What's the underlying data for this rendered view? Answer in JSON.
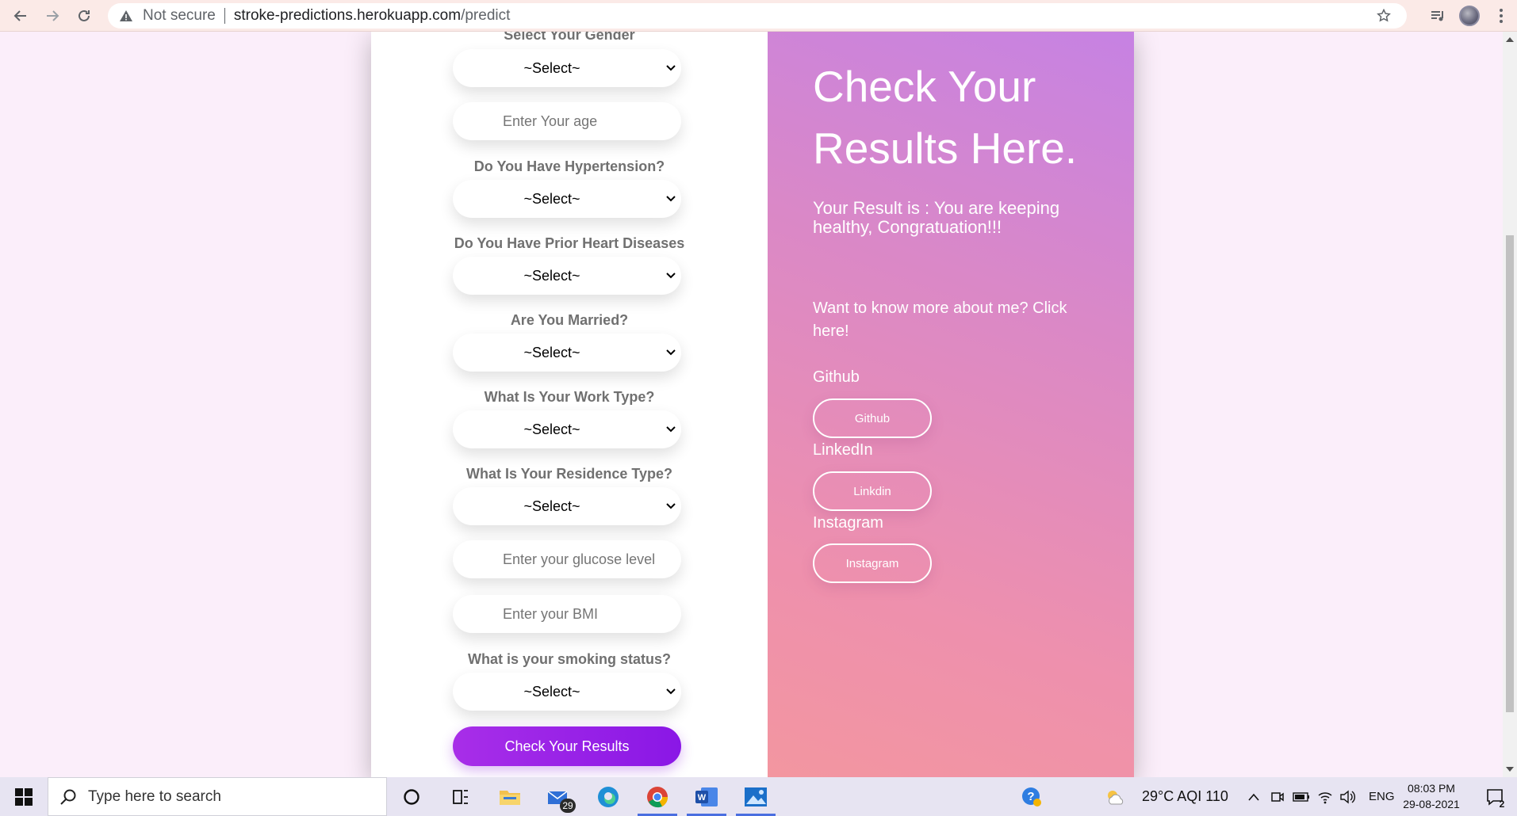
{
  "browser": {
    "security_label": "Not secure",
    "url_host": "stroke-predictions.herokuapp.com",
    "url_path": "/predict"
  },
  "form": {
    "gender_label": "Select Your Gender",
    "gender_value": "~Select~",
    "age_placeholder": "Enter Your age",
    "hypertension_label": "Do You Have Hypertension?",
    "hypertension_value": "~Select~",
    "heart_label": "Do You Have Prior Heart Diseases",
    "heart_value": "~Select~",
    "married_label": "Are You Married?",
    "married_value": "~Select~",
    "work_label": "What Is Your Work Type?",
    "work_value": "~Select~",
    "residence_label": "What Is Your Residence Type?",
    "residence_value": "~Select~",
    "glucose_placeholder": "Enter your glucose level",
    "bmi_placeholder": "Enter your BMI",
    "smoking_label": "What is your smoking status?",
    "smoking_value": "~Select~",
    "submit_label": "Check Your Results"
  },
  "result": {
    "title": "Check Your Results Here.",
    "result_text": "Your Result is : You are keeping healthy, Congratuation!!!",
    "more_text": "Want to know more about me? Click here!",
    "github_label": "Github",
    "github_button": "Github",
    "linkedin_label": "LinkedIn",
    "linkedin_button": "Linkdin",
    "instagram_label": "Instagram",
    "instagram_button": "Instagram"
  },
  "taskbar": {
    "search_placeholder": "Type here to search",
    "mail_badge": "29",
    "weather": "29°C  AQI 110",
    "language": "ENG",
    "time": "08:03 PM",
    "date": "29-08-2021",
    "notification_count": "2"
  },
  "colors": {
    "submit_gradient_start": "#a82ee8",
    "submit_gradient_end": "#8a17e6",
    "result_gradient_top": "#c682e3",
    "result_gradient_bottom": "#f396a0"
  }
}
